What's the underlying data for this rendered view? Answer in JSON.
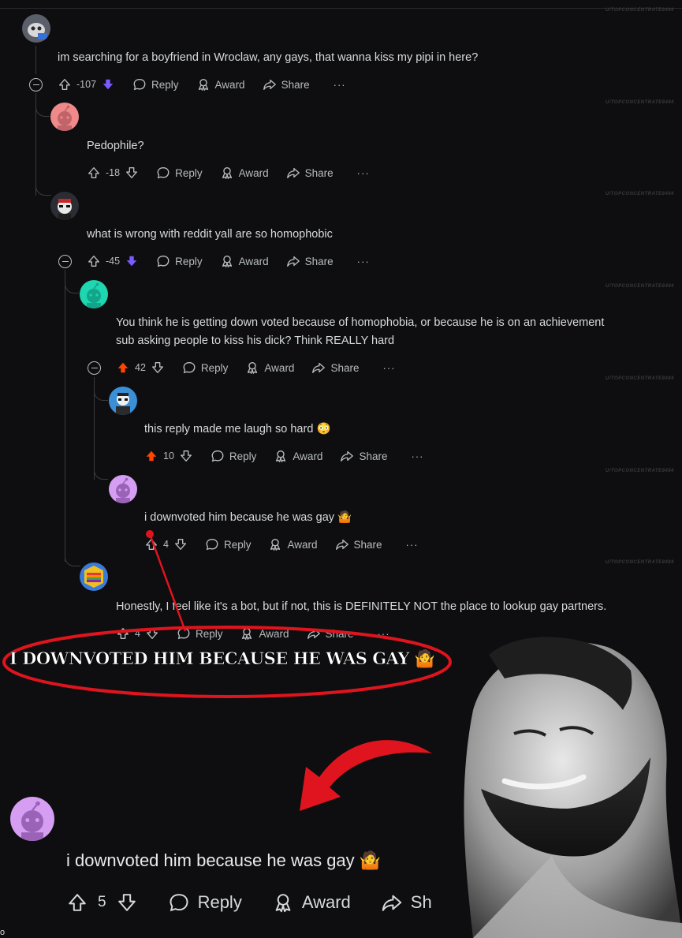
{
  "watermark": "U/TOPCONCENTRATE8484",
  "labels": {
    "reply": "Reply",
    "award": "Award",
    "share": "Share",
    "more": "···"
  },
  "colors": {
    "upvote": "#ff4500",
    "downvote": "#7a5bff",
    "annotation_red": "#e0141e"
  },
  "comments": [
    {
      "text": "im searching for a boyfriend in Wroclaw, any gays, that wanna kiss my pipi in here?",
      "votes": "-107",
      "vote_state": "down"
    },
    {
      "text": "Pedophile?",
      "votes": "-18",
      "vote_state": "none"
    },
    {
      "text": "what is wrong with reddit yall are so homophobic",
      "votes": "-45",
      "vote_state": "down"
    },
    {
      "text_line1": "You think he is getting down voted because of homophobia, or because he is on an achievement",
      "text_line2": "sub asking people to kiss his dick? Think REALLY hard",
      "votes": "42",
      "vote_state": "up"
    },
    {
      "text": "this reply made me laugh so hard",
      "emoji": "😳",
      "votes": "10",
      "vote_state": "up"
    },
    {
      "text": "i downvoted him because he was gay",
      "emoji": "🤷",
      "votes": "4",
      "vote_state": "none"
    },
    {
      "text": "Honestly, I feel like it's a bot, but if not, this is DEFINITELY NOT the place to lookup gay partners.",
      "votes": "4",
      "vote_state": "none"
    }
  ],
  "banner": {
    "text": "I DOWNVOTED HIM BECAUSE HE WAS GAY",
    "emoji": "🤷"
  },
  "zoom": {
    "text": "i downvoted him because he was gay",
    "emoji": "🤷",
    "votes": "5",
    "reply": "Reply",
    "award": "Award",
    "share_partial": "Sh"
  },
  "corner_mark": "o"
}
